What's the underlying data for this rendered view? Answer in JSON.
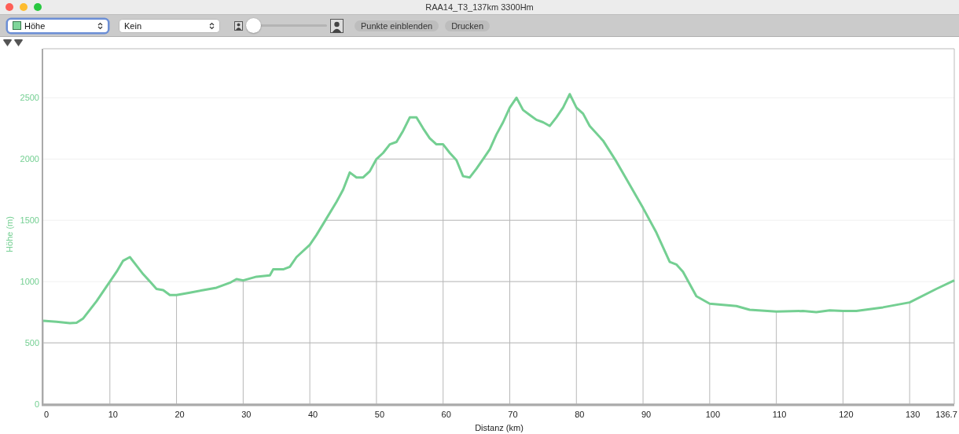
{
  "window": {
    "title": "RAA14_T3_137km 3300Hm"
  },
  "toolbar": {
    "series_select": {
      "focused": true
    },
    "overlay_select": {
      "value": "Kein",
      "focused": false
    },
    "slider": {
      "level": 0
    },
    "buttons": [
      "Punkte einblenden",
      "Drucken"
    ]
  },
  "chart": {
    "chart_data": {
      "type": "line",
      "xlabel": "Distanz (km)",
      "ylabel": "Höhe (m)",
      "x": [
        0,
        2,
        4,
        5,
        6,
        8,
        10,
        11,
        12,
        13,
        14,
        15,
        16,
        17,
        18,
        19,
        20,
        22,
        24,
        26,
        28,
        29,
        30,
        32,
        34,
        34.5,
        36,
        37,
        38,
        40,
        41,
        42,
        44,
        45,
        46,
        47,
        48,
        49,
        50,
        51,
        52,
        53,
        54,
        55,
        56,
        57,
        58,
        59,
        60,
        61,
        62,
        63,
        64,
        65,
        66,
        67,
        68,
        69,
        70,
        71,
        72,
        73,
        74,
        75,
        76,
        77,
        78,
        79,
        80,
        81,
        82,
        84,
        86,
        88,
        90,
        92,
        94,
        95,
        96,
        97,
        98,
        100,
        104,
        106,
        110,
        114,
        116,
        118,
        120,
        122,
        126,
        130,
        134,
        136.7
      ],
      "series": [
        {
          "name": "Höhe",
          "color": "#74cf92",
          "values": [
            680,
            672,
            660,
            665,
            700,
            840,
            1000,
            1080,
            1170,
            1200,
            1130,
            1060,
            1000,
            940,
            930,
            890,
            890,
            910,
            930,
            950,
            990,
            1020,
            1010,
            1040,
            1050,
            1100,
            1100,
            1120,
            1200,
            1300,
            1380,
            1470,
            1650,
            1750,
            1890,
            1850,
            1850,
            1900,
            2000,
            2050,
            2120,
            2140,
            2230,
            2340,
            2340,
            2250,
            2170,
            2120,
            2120,
            2050,
            1990,
            1860,
            1850,
            1920,
            2000,
            2080,
            2200,
            2300,
            2420,
            2500,
            2400,
            2360,
            2320,
            2300,
            2270,
            2340,
            2420,
            2530,
            2420,
            2370,
            2270,
            2150,
            1980,
            1790,
            1600,
            1400,
            1160,
            1140,
            1080,
            980,
            880,
            820,
            800,
            770,
            755,
            760,
            750,
            765,
            760,
            760,
            790,
            830,
            940,
            1010
          ]
        }
      ],
      "grid": true,
      "xlim": [
        0,
        136.7
      ],
      "ylim": [
        0,
        2900
      ],
      "xticks": [
        0,
        10,
        20,
        30,
        40,
        50,
        60,
        70,
        80,
        90,
        100,
        110,
        120,
        130,
        136.7
      ],
      "yticks": [
        0,
        500,
        1000,
        1500,
        2000,
        2500
      ]
    }
  }
}
